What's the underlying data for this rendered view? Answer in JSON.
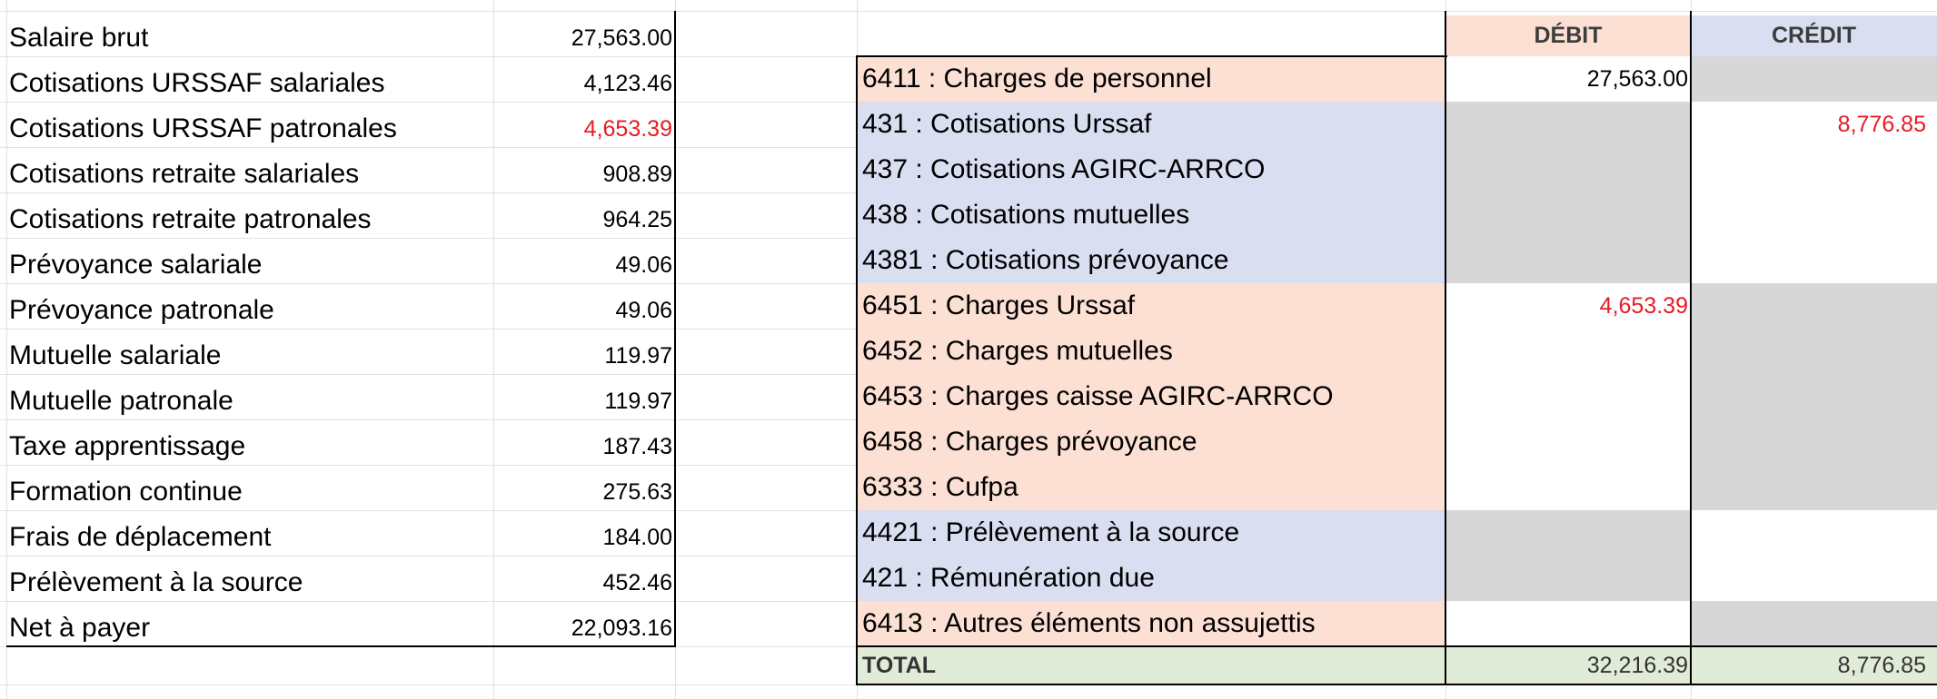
{
  "colors": {
    "salmon": "#fce0d4",
    "blue": "#d9def1",
    "gray": "#d7d7d7",
    "green": "#e1ecd8",
    "red": "#e51c23"
  },
  "left_table": {
    "rows": [
      {
        "label": "Salaire brut",
        "value": "27,563.00"
      },
      {
        "label": "Cotisations URSSAF salariales",
        "value": "4,123.46"
      },
      {
        "label": "Cotisations URSSAF patronales",
        "value": "4,653.39"
      },
      {
        "label": "Cotisations retraite salariales",
        "value": "908.89"
      },
      {
        "label": "Cotisations retraite patronales",
        "value": "964.25"
      },
      {
        "label": "Prévoyance salariale",
        "value": "49.06"
      },
      {
        "label": "Prévoyance patronale",
        "value": "49.06"
      },
      {
        "label": "Mutuelle salariale",
        "value": "119.97"
      },
      {
        "label": "Mutuelle patronale",
        "value": "119.97"
      },
      {
        "label": "Taxe apprentissage",
        "value": "187.43"
      },
      {
        "label": "Formation continue",
        "value": "275.63"
      },
      {
        "label": "Frais de déplacement",
        "value": "184.00"
      },
      {
        "label": "Prélèvement à la source",
        "value": "452.46"
      },
      {
        "label": "Net à payer",
        "value": "22,093.16"
      }
    ]
  },
  "journal": {
    "debit_header": "DÉBIT",
    "credit_header": "CRÉDIT",
    "rows": [
      {
        "account": "6411 : Charges de personnel",
        "debit": "27,563.00",
        "credit": ""
      },
      {
        "account": "431 : Cotisations Urssaf",
        "debit": "",
        "credit": "8,776.85"
      },
      {
        "account": "437 : Cotisations AGIRC-ARRCO",
        "debit": "",
        "credit": ""
      },
      {
        "account": "438 : Cotisations mutuelles",
        "debit": "",
        "credit": ""
      },
      {
        "account": "4381 : Cotisations prévoyance",
        "debit": "",
        "credit": ""
      },
      {
        "account": "6451 : Charges Urssaf",
        "debit": "4,653.39",
        "credit": ""
      },
      {
        "account": "6452 : Charges mutuelles",
        "debit": "",
        "credit": ""
      },
      {
        "account": "6453 : Charges caisse AGIRC-ARRCO",
        "debit": "",
        "credit": ""
      },
      {
        "account": "6458 : Charges prévoyance",
        "debit": "",
        "credit": ""
      },
      {
        "account": "6333 : Cufpa",
        "debit": "",
        "credit": ""
      },
      {
        "account": "4421 : Prélèvement à la source",
        "debit": "",
        "credit": ""
      },
      {
        "account": "421 : Rémunération due",
        "debit": "",
        "credit": ""
      },
      {
        "account": "6413 : Autres éléments non assujettis",
        "debit": "",
        "credit": ""
      }
    ],
    "total": {
      "label": "TOTAL",
      "debit": "32,216.39",
      "credit": "8,776.85"
    }
  }
}
